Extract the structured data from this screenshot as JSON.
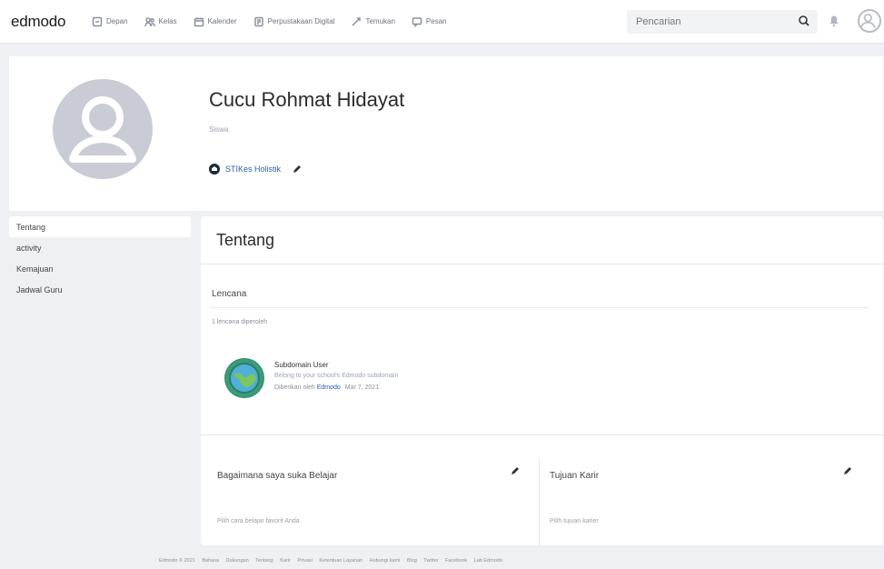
{
  "nav": {
    "logo": "edmodo",
    "items": [
      {
        "label": "Depan",
        "icon": "home-icon"
      },
      {
        "label": "Kelas",
        "icon": "classes-icon"
      },
      {
        "label": "Kalender",
        "icon": "calendar-icon"
      },
      {
        "label": "Perpustakaan Digital",
        "icon": "library-icon"
      },
      {
        "label": "Temukan",
        "icon": "discover-icon"
      },
      {
        "label": "Pesan",
        "icon": "messages-icon"
      }
    ],
    "search_placeholder": "Pencarian"
  },
  "profile": {
    "name": "Cucu Rohmat Hidayat",
    "role": "Siswa",
    "school": "STIKes Holistik"
  },
  "sidebar": {
    "items": [
      {
        "label": "Tentang",
        "active": true
      },
      {
        "label": "activity",
        "active": false
      },
      {
        "label": "Kemajuan",
        "active": false
      },
      {
        "label": "Jadwal Guru",
        "active": false
      }
    ]
  },
  "about": {
    "title": "Tentang",
    "badges_title": "Lencana",
    "badges_count": "1 lencana diperoleh",
    "badge": {
      "title": "Subdomain User",
      "description": "Belong to your school's Edmodo subdomain",
      "given_by_prefix": "Diberikan oleh",
      "given_by_org": "Edmodo",
      "date": "Mar 7, 2021"
    },
    "learning": {
      "title": "Bagaimana saya suka Belajar",
      "placeholder": "Pilih cara belajar favorit Anda"
    },
    "career": {
      "title": "Tujuan Karir",
      "placeholder": "Pilih tujuan karier"
    }
  },
  "footer": {
    "items": [
      "Edmodo © 2021",
      "Bahasa",
      "Dukungan",
      "Tentang",
      "Karir",
      "Privasi",
      "Ketentuan Layanan",
      "Hubungi kami",
      "Blog",
      "Twitter",
      "Facebook",
      "Lab Edmodo"
    ]
  },
  "colors": {
    "link": "#2f5fa6",
    "background": "#eef0f3",
    "badge": "#2f8a6c"
  }
}
